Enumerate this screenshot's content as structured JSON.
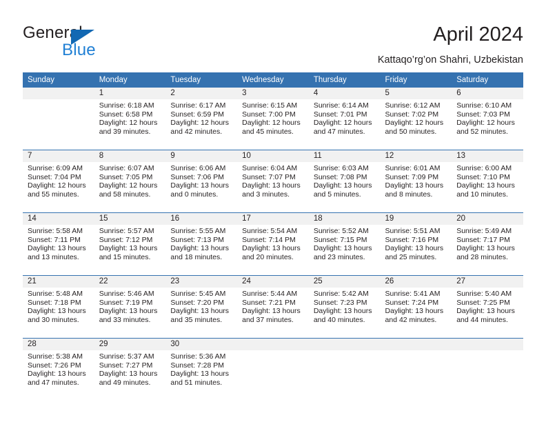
{
  "brand": {
    "name_part1": "General",
    "name_part2": "Blue",
    "accent_color": "#1268b3",
    "blue_text_color": "#1f7fd4",
    "logo_icon": "triangle-flag-icon"
  },
  "header": {
    "title": "April 2024",
    "subtitle": "Kattaqo’rg’on Shahri, Uzbekistan"
  },
  "calendar": {
    "header_bg_color": "#3572b0",
    "daynum_bg_color": "#f1f1f1",
    "weekday_headers": [
      "Sunday",
      "Monday",
      "Tuesday",
      "Wednesday",
      "Thursday",
      "Friday",
      "Saturday"
    ],
    "weeks": [
      [
        {
          "day": "",
          "sunrise": "",
          "sunset": "",
          "daylight_line1": "",
          "daylight_line2": "",
          "empty": true
        },
        {
          "day": "1",
          "sunrise": "Sunrise: 6:18 AM",
          "sunset": "Sunset: 6:58 PM",
          "daylight_line1": "Daylight: 12 hours",
          "daylight_line2": "and 39 minutes.",
          "empty": false
        },
        {
          "day": "2",
          "sunrise": "Sunrise: 6:17 AM",
          "sunset": "Sunset: 6:59 PM",
          "daylight_line1": "Daylight: 12 hours",
          "daylight_line2": "and 42 minutes.",
          "empty": false
        },
        {
          "day": "3",
          "sunrise": "Sunrise: 6:15 AM",
          "sunset": "Sunset: 7:00 PM",
          "daylight_line1": "Daylight: 12 hours",
          "daylight_line2": "and 45 minutes.",
          "empty": false
        },
        {
          "day": "4",
          "sunrise": "Sunrise: 6:14 AM",
          "sunset": "Sunset: 7:01 PM",
          "daylight_line1": "Daylight: 12 hours",
          "daylight_line2": "and 47 minutes.",
          "empty": false
        },
        {
          "day": "5",
          "sunrise": "Sunrise: 6:12 AM",
          "sunset": "Sunset: 7:02 PM",
          "daylight_line1": "Daylight: 12 hours",
          "daylight_line2": "and 50 minutes.",
          "empty": false
        },
        {
          "day": "6",
          "sunrise": "Sunrise: 6:10 AM",
          "sunset": "Sunset: 7:03 PM",
          "daylight_line1": "Daylight: 12 hours",
          "daylight_line2": "and 52 minutes.",
          "empty": false
        }
      ],
      [
        {
          "day": "7",
          "sunrise": "Sunrise: 6:09 AM",
          "sunset": "Sunset: 7:04 PM",
          "daylight_line1": "Daylight: 12 hours",
          "daylight_line2": "and 55 minutes.",
          "empty": false
        },
        {
          "day": "8",
          "sunrise": "Sunrise: 6:07 AM",
          "sunset": "Sunset: 7:05 PM",
          "daylight_line1": "Daylight: 12 hours",
          "daylight_line2": "and 58 minutes.",
          "empty": false
        },
        {
          "day": "9",
          "sunrise": "Sunrise: 6:06 AM",
          "sunset": "Sunset: 7:06 PM",
          "daylight_line1": "Daylight: 13 hours",
          "daylight_line2": "and 0 minutes.",
          "empty": false
        },
        {
          "day": "10",
          "sunrise": "Sunrise: 6:04 AM",
          "sunset": "Sunset: 7:07 PM",
          "daylight_line1": "Daylight: 13 hours",
          "daylight_line2": "and 3 minutes.",
          "empty": false
        },
        {
          "day": "11",
          "sunrise": "Sunrise: 6:03 AM",
          "sunset": "Sunset: 7:08 PM",
          "daylight_line1": "Daylight: 13 hours",
          "daylight_line2": "and 5 minutes.",
          "empty": false
        },
        {
          "day": "12",
          "sunrise": "Sunrise: 6:01 AM",
          "sunset": "Sunset: 7:09 PM",
          "daylight_line1": "Daylight: 13 hours",
          "daylight_line2": "and 8 minutes.",
          "empty": false
        },
        {
          "day": "13",
          "sunrise": "Sunrise: 6:00 AM",
          "sunset": "Sunset: 7:10 PM",
          "daylight_line1": "Daylight: 13 hours",
          "daylight_line2": "and 10 minutes.",
          "empty": false
        }
      ],
      [
        {
          "day": "14",
          "sunrise": "Sunrise: 5:58 AM",
          "sunset": "Sunset: 7:11 PM",
          "daylight_line1": "Daylight: 13 hours",
          "daylight_line2": "and 13 minutes.",
          "empty": false
        },
        {
          "day": "15",
          "sunrise": "Sunrise: 5:57 AM",
          "sunset": "Sunset: 7:12 PM",
          "daylight_line1": "Daylight: 13 hours",
          "daylight_line2": "and 15 minutes.",
          "empty": false
        },
        {
          "day": "16",
          "sunrise": "Sunrise: 5:55 AM",
          "sunset": "Sunset: 7:13 PM",
          "daylight_line1": "Daylight: 13 hours",
          "daylight_line2": "and 18 minutes.",
          "empty": false
        },
        {
          "day": "17",
          "sunrise": "Sunrise: 5:54 AM",
          "sunset": "Sunset: 7:14 PM",
          "daylight_line1": "Daylight: 13 hours",
          "daylight_line2": "and 20 minutes.",
          "empty": false
        },
        {
          "day": "18",
          "sunrise": "Sunrise: 5:52 AM",
          "sunset": "Sunset: 7:15 PM",
          "daylight_line1": "Daylight: 13 hours",
          "daylight_line2": "and 23 minutes.",
          "empty": false
        },
        {
          "day": "19",
          "sunrise": "Sunrise: 5:51 AM",
          "sunset": "Sunset: 7:16 PM",
          "daylight_line1": "Daylight: 13 hours",
          "daylight_line2": "and 25 minutes.",
          "empty": false
        },
        {
          "day": "20",
          "sunrise": "Sunrise: 5:49 AM",
          "sunset": "Sunset: 7:17 PM",
          "daylight_line1": "Daylight: 13 hours",
          "daylight_line2": "and 28 minutes.",
          "empty": false
        }
      ],
      [
        {
          "day": "21",
          "sunrise": "Sunrise: 5:48 AM",
          "sunset": "Sunset: 7:18 PM",
          "daylight_line1": "Daylight: 13 hours",
          "daylight_line2": "and 30 minutes.",
          "empty": false
        },
        {
          "day": "22",
          "sunrise": "Sunrise: 5:46 AM",
          "sunset": "Sunset: 7:19 PM",
          "daylight_line1": "Daylight: 13 hours",
          "daylight_line2": "and 33 minutes.",
          "empty": false
        },
        {
          "day": "23",
          "sunrise": "Sunrise: 5:45 AM",
          "sunset": "Sunset: 7:20 PM",
          "daylight_line1": "Daylight: 13 hours",
          "daylight_line2": "and 35 minutes.",
          "empty": false
        },
        {
          "day": "24",
          "sunrise": "Sunrise: 5:44 AM",
          "sunset": "Sunset: 7:21 PM",
          "daylight_line1": "Daylight: 13 hours",
          "daylight_line2": "and 37 minutes.",
          "empty": false
        },
        {
          "day": "25",
          "sunrise": "Sunrise: 5:42 AM",
          "sunset": "Sunset: 7:23 PM",
          "daylight_line1": "Daylight: 13 hours",
          "daylight_line2": "and 40 minutes.",
          "empty": false
        },
        {
          "day": "26",
          "sunrise": "Sunrise: 5:41 AM",
          "sunset": "Sunset: 7:24 PM",
          "daylight_line1": "Daylight: 13 hours",
          "daylight_line2": "and 42 minutes.",
          "empty": false
        },
        {
          "day": "27",
          "sunrise": "Sunrise: 5:40 AM",
          "sunset": "Sunset: 7:25 PM",
          "daylight_line1": "Daylight: 13 hours",
          "daylight_line2": "and 44 minutes.",
          "empty": false
        }
      ],
      [
        {
          "day": "28",
          "sunrise": "Sunrise: 5:38 AM",
          "sunset": "Sunset: 7:26 PM",
          "daylight_line1": "Daylight: 13 hours",
          "daylight_line2": "and 47 minutes.",
          "empty": false
        },
        {
          "day": "29",
          "sunrise": "Sunrise: 5:37 AM",
          "sunset": "Sunset: 7:27 PM",
          "daylight_line1": "Daylight: 13 hours",
          "daylight_line2": "and 49 minutes.",
          "empty": false
        },
        {
          "day": "30",
          "sunrise": "Sunrise: 5:36 AM",
          "sunset": "Sunset: 7:28 PM",
          "daylight_line1": "Daylight: 13 hours",
          "daylight_line2": "and 51 minutes.",
          "empty": false
        },
        {
          "day": "",
          "sunrise": "",
          "sunset": "",
          "daylight_line1": "",
          "daylight_line2": "",
          "empty": true
        },
        {
          "day": "",
          "sunrise": "",
          "sunset": "",
          "daylight_line1": "",
          "daylight_line2": "",
          "empty": true
        },
        {
          "day": "",
          "sunrise": "",
          "sunset": "",
          "daylight_line1": "",
          "daylight_line2": "",
          "empty": true
        },
        {
          "day": "",
          "sunrise": "",
          "sunset": "",
          "daylight_line1": "",
          "daylight_line2": "",
          "empty": true
        }
      ]
    ]
  }
}
